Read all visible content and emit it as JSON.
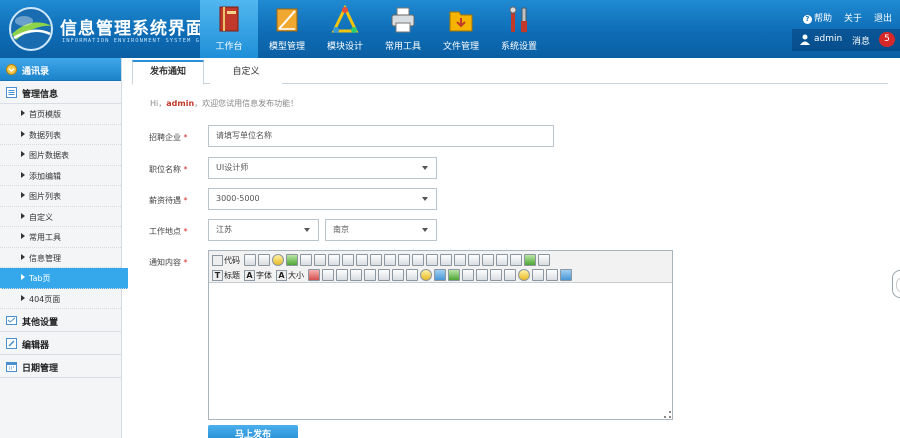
{
  "header": {
    "title": "信息管理系统界面",
    "subtitle": "INFORMATION ENVIRONMENT SYSTEM GUI",
    "nav": [
      {
        "label": "工作台",
        "icon": "workbench-icon",
        "active": true
      },
      {
        "label": "模型管理",
        "icon": "model-icon"
      },
      {
        "label": "模块设计",
        "icon": "module-icon"
      },
      {
        "label": "常用工具",
        "icon": "printer-icon"
      },
      {
        "label": "文件管理",
        "icon": "folder-icon"
      },
      {
        "label": "系统设置",
        "icon": "tools-icon"
      }
    ],
    "help": "帮助",
    "about": "关于",
    "logout": "退出",
    "help_mark": "?",
    "user": "admin",
    "message_label": "消息",
    "message_count": "5"
  },
  "sidebar": {
    "groups": [
      {
        "label": "通讯录",
        "icon": "contacts-icon"
      },
      {
        "label": "管理信息",
        "icon": "list-icon"
      }
    ],
    "items": [
      {
        "label": "首页模版"
      },
      {
        "label": "数据列表"
      },
      {
        "label": "图片数据表"
      },
      {
        "label": "添加编辑"
      },
      {
        "label": "图片列表"
      },
      {
        "label": "自定义"
      },
      {
        "label": "常用工具"
      },
      {
        "label": "信息管理"
      },
      {
        "label": "Tab页",
        "active": true
      },
      {
        "label": "404页面"
      }
    ],
    "groups_bottom": [
      {
        "label": "其他设置",
        "icon": "settings-icon"
      },
      {
        "label": "编辑器",
        "icon": "edit-icon"
      },
      {
        "label": "日期管理",
        "icon": "calendar-icon"
      }
    ]
  },
  "main": {
    "tabs": [
      {
        "label": "发布通知",
        "active": true
      },
      {
        "label": "自定义"
      }
    ],
    "hint_prefix": "Hi，",
    "hint_user": "admin",
    "hint_suffix": "，欢迎您试用信息发布功能！",
    "form": {
      "company_label": "招聘企业",
      "company_placeholder": "请填写单位名称",
      "position_label": "职位名称",
      "position_value": "UI设计师",
      "salary_label": "薪资待遇",
      "salary_value": "3000-5000",
      "location_label": "工作地点",
      "province_value": "江苏",
      "city_value": "南京",
      "content_label": "通知内容",
      "required_mark": "*"
    },
    "editor": {
      "code_label": "代码",
      "title_label": "标题",
      "font_label": "字体",
      "size_label": "大小"
    },
    "submit_label": "马上发布"
  }
}
